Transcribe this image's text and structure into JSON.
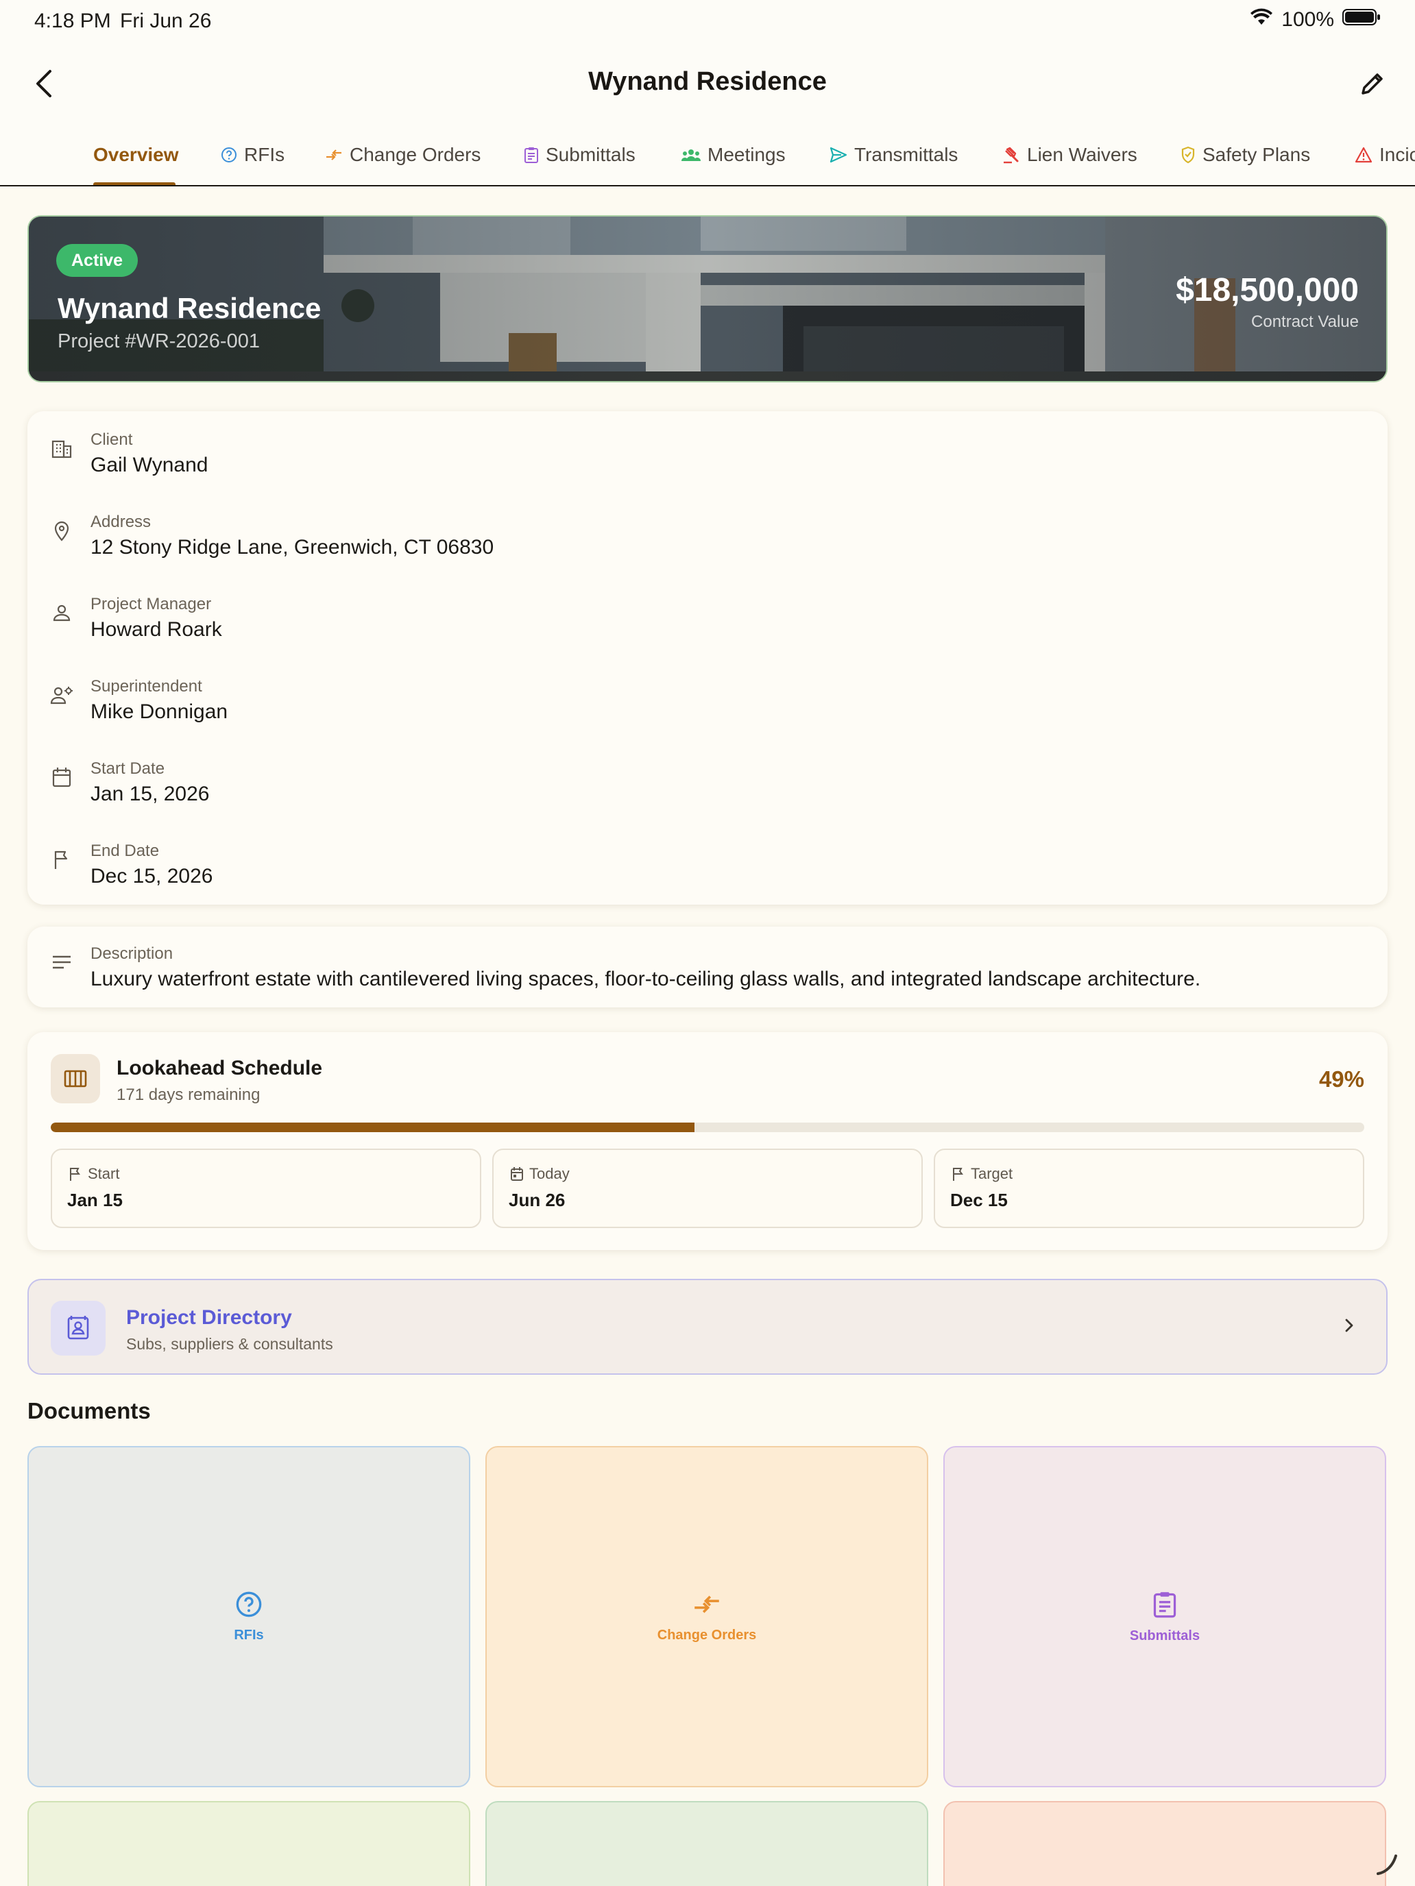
{
  "status_bar": {
    "time": "4:18 PM",
    "date": "Fri Jun 26",
    "battery": "100%"
  },
  "nav": {
    "title": "Wynand Residence"
  },
  "tabs": [
    {
      "label": "Overview",
      "icon": "none",
      "active": true
    },
    {
      "label": "RFIs",
      "icon": "question-circle-icon"
    },
    {
      "label": "Change Orders",
      "icon": "swap-arrows-icon"
    },
    {
      "label": "Submittals",
      "icon": "clipboard-icon"
    },
    {
      "label": "Meetings",
      "icon": "group-icon"
    },
    {
      "label": "Transmittals",
      "icon": "send-icon"
    },
    {
      "label": "Lien Waivers",
      "icon": "gavel-icon"
    },
    {
      "label": "Safety Plans",
      "icon": "shield-icon"
    },
    {
      "label": "Incic",
      "icon": "warning-icon"
    }
  ],
  "hero": {
    "status": "Active",
    "title": "Wynand Residence",
    "project_number": "Project #WR-2026-001",
    "contract_value": "$18,500,000",
    "contract_value_label": "Contract Value"
  },
  "details": {
    "client_label": "Client",
    "client": "Gail Wynand",
    "address_label": "Address",
    "address": "12 Stony Ridge Lane, Greenwich, CT 06830",
    "pm_label": "Project Manager",
    "pm": "Howard Roark",
    "super_label": "Superintendent",
    "super": "Mike Donnigan",
    "start_label": "Start Date",
    "start": "Jan 15, 2026",
    "end_label": "End Date",
    "end": "Dec 15, 2026"
  },
  "description": {
    "label": "Description",
    "text": "Luxury waterfront estate with cantilevered living spaces, floor-to-ceiling glass walls, and integrated landscape architecture."
  },
  "schedule": {
    "title": "Lookahead Schedule",
    "remaining": "171 days remaining",
    "percent_label": "49%",
    "progress_fraction": 0.49,
    "start_label": "Start",
    "start": "Jan 15",
    "today_label": "Today",
    "today": "Jun 26",
    "target_label": "Target",
    "target": "Dec 15"
  },
  "directory": {
    "title": "Project Directory",
    "subtitle": "Subs, suppliers & consultants"
  },
  "documents": {
    "title": "Documents",
    "tiles": [
      {
        "label": "RFIs",
        "color": "#3b8fd9",
        "bg": "#eaebe8",
        "border": "#b8d2ea"
      },
      {
        "label": "Change Orders",
        "color": "#e8902f",
        "bg": "#fdecd4",
        "border": "#f3cfa3"
      },
      {
        "label": "Submittals",
        "color": "#9d5fd6",
        "bg": "#f3e8ea",
        "border": "#d7c1ec"
      }
    ],
    "row2_colors": [
      "#eef3dc",
      "#e6efdd",
      "#fce4d6"
    ]
  },
  "colors": {
    "accent": "#93580f",
    "active_badge": "#3db86a",
    "directory_accent": "#5b5bd6"
  }
}
